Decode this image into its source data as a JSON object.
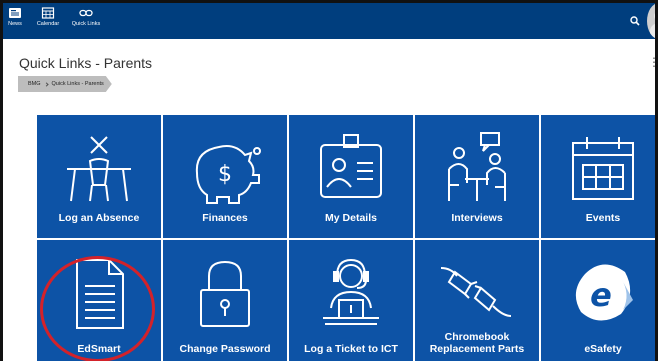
{
  "nav": {
    "items": [
      {
        "label": "News",
        "icon": "news-icon"
      },
      {
        "label": "Calendar",
        "icon": "calendar-icon"
      },
      {
        "label": "Quick Links",
        "icon": "link-icon"
      }
    ],
    "search_icon": "search-icon"
  },
  "page": {
    "title": "Quick Links - Parents",
    "breadcrumb": [
      "BMG",
      "Quick Links - Parents"
    ]
  },
  "tiles": [
    {
      "label": "Log an Absence",
      "icon": "desk-absence-icon"
    },
    {
      "label": "Finances",
      "icon": "piggy-bank-icon"
    },
    {
      "label": "My Details",
      "icon": "id-card-icon"
    },
    {
      "label": "Interviews",
      "icon": "interview-icon"
    },
    {
      "label": "Events",
      "icon": "calendar-events-icon"
    },
    {
      "label": "EdSmart",
      "icon": "document-icon"
    },
    {
      "label": "Change Password",
      "icon": "padlock-icon"
    },
    {
      "label": "Log a Ticket to ICT",
      "icon": "headset-support-icon"
    },
    {
      "label": "Chromebook Replacement Parts",
      "icon": "cable-plug-icon"
    },
    {
      "label": "eSafety",
      "icon": "esafety-logo-icon"
    }
  ],
  "colors": {
    "header": "#003e7e",
    "tile": "#0d53a6",
    "highlight": "#d3222a"
  }
}
